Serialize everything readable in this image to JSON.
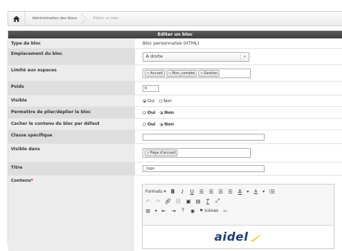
{
  "breadcrumb": {
    "items": [
      "Administration des blocs",
      "Editer un bloc"
    ]
  },
  "form": {
    "header": "Editer un bloc",
    "rows": {
      "type": {
        "label": "Type de bloc",
        "value": "Bloc personnalisé (HTML)"
      },
      "placement": {
        "label": "Emplacement du bloc",
        "selected": "A droite"
      },
      "spaces": {
        "label": "Limité aux espaces",
        "tags": [
          "Accueil",
          "Mon_compte",
          "Gestion"
        ]
      },
      "weight": {
        "label": "Poids",
        "value": "0"
      },
      "visible": {
        "label": "Visible",
        "options": [
          "Oui",
          "Non"
        ],
        "selected": "Oui"
      },
      "fold": {
        "label": "Permettre de plier/déplier le bloc",
        "options": [
          "Oui",
          "Non"
        ],
        "selected": "Non"
      },
      "hide": {
        "label": "Cacher le contenu du bloc par défaut",
        "options": [
          "Oui",
          "Non"
        ],
        "selected": "Non"
      },
      "cssclass": {
        "label": "Classe spécifique",
        "value": ""
      },
      "visible_in": {
        "label": "Visible dans",
        "tags": [
          "Page d'accueil"
        ]
      },
      "title": {
        "label": "Titre",
        "value": "_logo"
      },
      "content": {
        "label": "Contenu",
        "required_mark": "*"
      }
    }
  },
  "editor": {
    "formats_label": "Formats",
    "icons_label": "Icônes",
    "logo_text": "aidel"
  },
  "colors": {
    "header_bg": "#4a4a4a",
    "label_bg": "#ececec",
    "required": "#cc0000",
    "logo_blue": "#1f3d7a",
    "logo_yellow": "#f2c200"
  }
}
